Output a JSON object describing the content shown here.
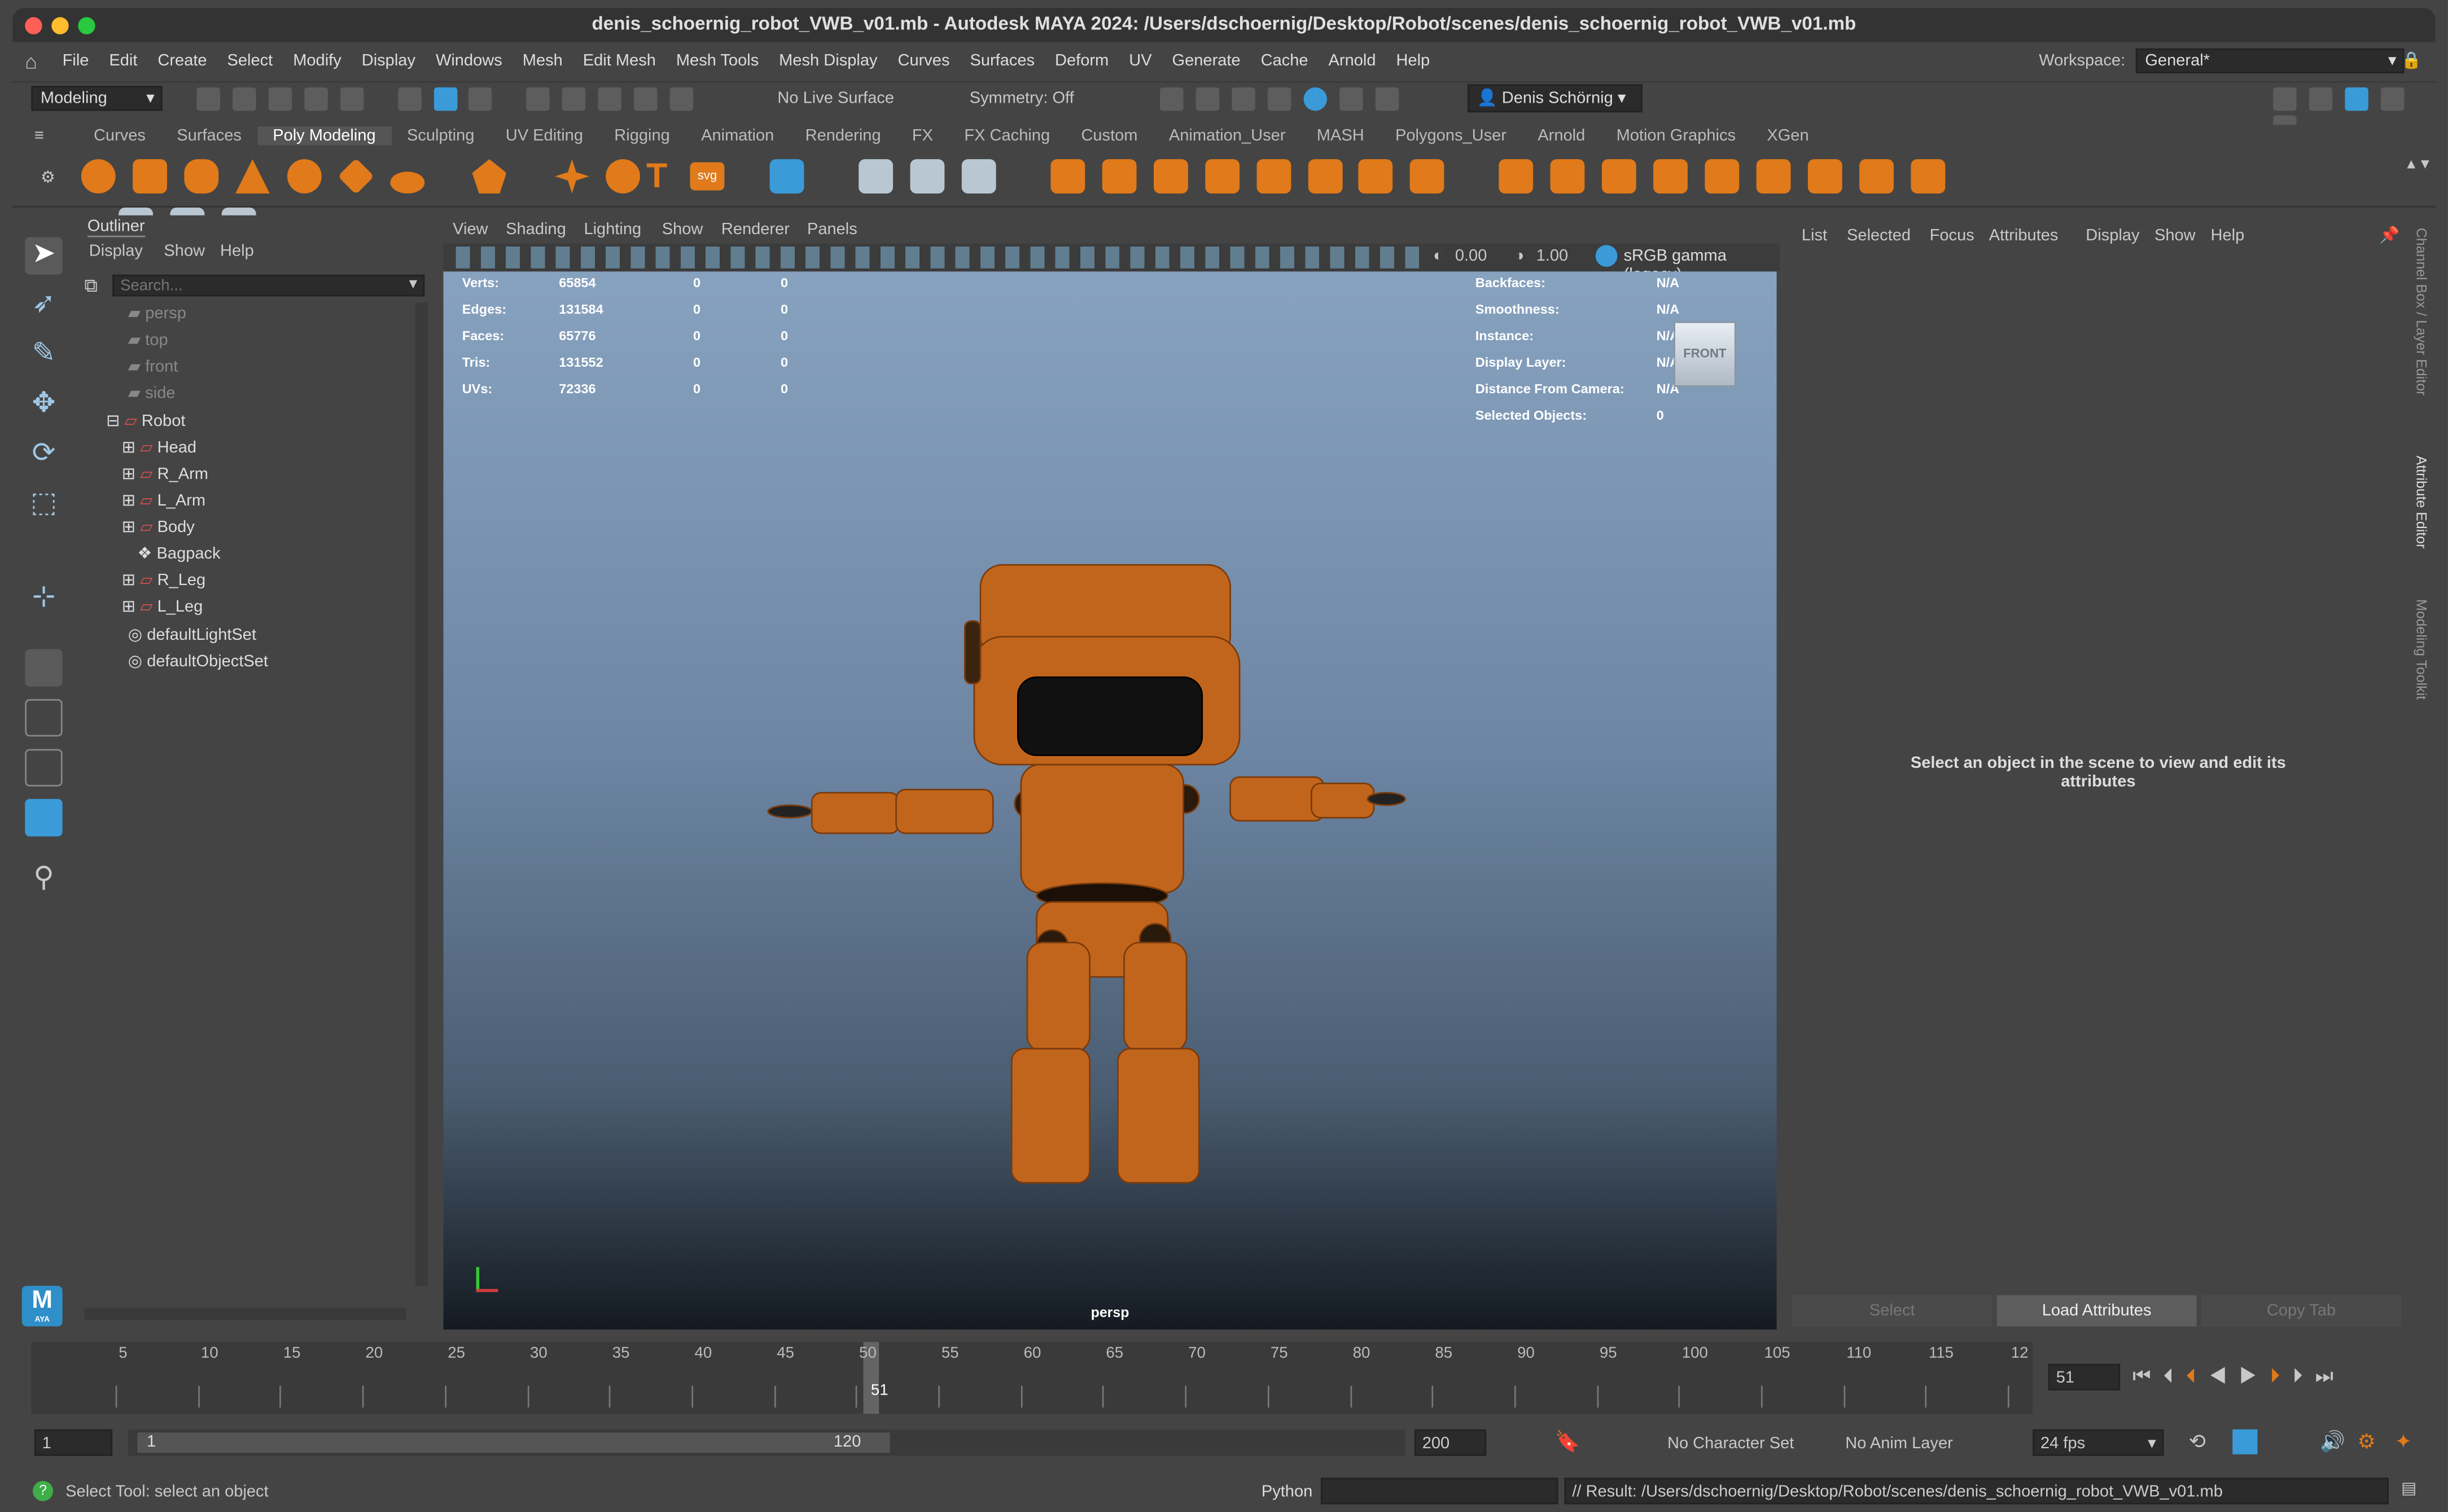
{
  "window": {
    "title": "denis_schoernig_robot_VWB_v01.mb - Autodesk MAYA 2024: /Users/dschoernig/Desktop/Robot/scenes/denis_schoernig_robot_VWB_v01.mb"
  },
  "menubar": {
    "items": [
      "File",
      "Edit",
      "Create",
      "Select",
      "Modify",
      "Display",
      "Windows",
      "Mesh",
      "Edit Mesh",
      "Mesh Tools",
      "Mesh Display",
      "Curves",
      "Surfaces",
      "Deform",
      "UV",
      "Generate",
      "Cache",
      "Arnold",
      "Help"
    ],
    "workspace_label": "Workspace:",
    "workspace_value": "General*"
  },
  "statusline": {
    "mode": "Modeling",
    "live_surface": "No Live Surface",
    "symmetry": "Symmetry: Off",
    "user": "Denis Schörnig"
  },
  "shelf": {
    "tabs": [
      "Curves",
      "Surfaces",
      "Poly Modeling",
      "Sculpting",
      "UV Editing",
      "Rigging",
      "Animation",
      "Rendering",
      "FX",
      "FX Caching",
      "Custom",
      "Animation_User",
      "MASH",
      "Polygons_User",
      "Arnold",
      "Motion Graphics",
      "XGen"
    ],
    "active_tab": "Poly Modeling",
    "text_icon": "T",
    "svg_icon": "svg"
  },
  "outliner": {
    "title": "Outliner",
    "menu": [
      "Display",
      "Show",
      "Help"
    ],
    "search_placeholder": "Search...",
    "cameras": [
      "persp",
      "top",
      "front",
      "side"
    ],
    "root": "Robot",
    "children": [
      "Head",
      "R_Arm",
      "L_Arm",
      "Body",
      "Bagpack",
      "R_Leg",
      "L_Leg"
    ],
    "sets": [
      "defaultLightSet",
      "defaultObjectSet"
    ]
  },
  "viewport": {
    "menu": [
      "View",
      "Shading",
      "Lighting",
      "Show",
      "Renderer",
      "Panels"
    ],
    "exposure": "0.00",
    "gamma": "1.00",
    "color_space": "sRGB gamma (legacy)",
    "camera_label": "persp",
    "viewcube_label": "FRONT",
    "hud_left": [
      {
        "label": "Verts:",
        "v1": "65854",
        "v2": "0",
        "v3": "0"
      },
      {
        "label": "Edges:",
        "v1": "131584",
        "v2": "0",
        "v3": "0"
      },
      {
        "label": "Faces:",
        "v1": "65776",
        "v2": "0",
        "v3": "0"
      },
      {
        "label": "Tris:",
        "v1": "131552",
        "v2": "0",
        "v3": "0"
      },
      {
        "label": "UVs:",
        "v1": "72336",
        "v2": "0",
        "v3": "0"
      }
    ],
    "hud_right": [
      {
        "label": "Backfaces:",
        "value": "N/A"
      },
      {
        "label": "Smoothness:",
        "value": "N/A"
      },
      {
        "label": "Instance:",
        "value": "N/A"
      },
      {
        "label": "Display Layer:",
        "value": "N/A"
      },
      {
        "label": "Distance From Camera:",
        "value": "N/A"
      },
      {
        "label": "Selected Objects:",
        "value": "0"
      }
    ],
    "model_color": "#c2651c"
  },
  "attribute_editor": {
    "menu": [
      "List",
      "Selected",
      "Focus",
      "Attributes",
      "Display",
      "Show",
      "Help"
    ],
    "message": "Select an object in the scene to view and edit its attributes",
    "buttons": [
      "Select",
      "Load Attributes",
      "Copy Tab"
    ],
    "side_tabs": [
      "Channel Box / Layer Editor",
      "Attribute Editor",
      "Modeling Toolkit"
    ]
  },
  "timeline": {
    "ticks": [
      "5",
      "10",
      "15",
      "20",
      "25",
      "30",
      "35",
      "40",
      "45",
      "50",
      "55",
      "60",
      "65",
      "70",
      "75",
      "80",
      "85",
      "90",
      "95",
      "100",
      "105",
      "110",
      "115",
      "12"
    ],
    "current_frame_label": "51",
    "current_frame_field": "51",
    "current_frame": 51,
    "range_end_frame": 120
  },
  "range": {
    "start": "1",
    "playback_start": "1",
    "playback_end": "120",
    "end": "200",
    "character_set": "No Character Set",
    "anim_layer": "No Anim Layer",
    "fps": "24 fps"
  },
  "commandline": {
    "help_text": "Select Tool: select an object",
    "language": "Python",
    "result": "// Result: /Users/dschoernig/Desktop/Robot/scenes/denis_schoernig_robot_VWB_v01.mb"
  },
  "colors": {
    "accent": "#3a9bd8",
    "shelf_orange": "#e07a1a",
    "panel": "#444444"
  },
  "logo": {
    "text": "M",
    "sub": "AYA"
  }
}
